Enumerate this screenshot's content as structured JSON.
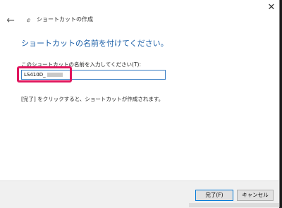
{
  "window": {
    "back_icon": "←",
    "app_icon": "ⅇ",
    "title": "ショートカットの作成",
    "close_icon": "✕"
  },
  "main": {
    "heading": "ショートカットの名前を付けてください。",
    "field_label": "このショートカットの名前を入力してください(T):",
    "input_value": "LS410D_",
    "info_text": "[完了] をクリックすると、ショートカットが作成されます。"
  },
  "footer": {
    "finish_label": "完了(F)",
    "cancel_label": "キャンセル"
  },
  "colors": {
    "heading": "#1b5fa8",
    "highlight": "#e0165e",
    "input_border": "#3c7fc4"
  }
}
